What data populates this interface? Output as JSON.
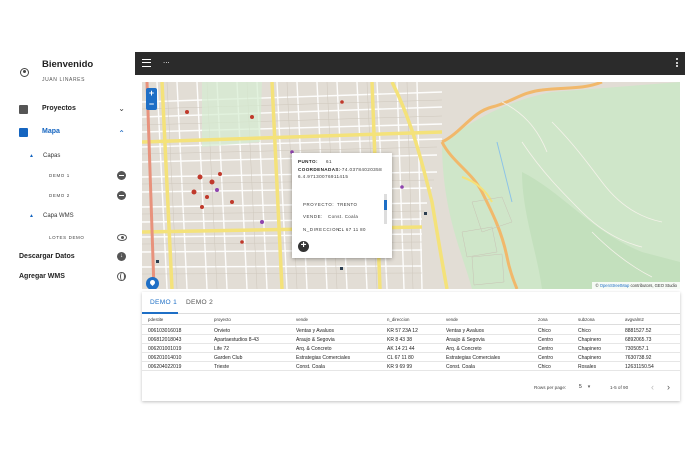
{
  "sidebar": {
    "greeting": "Bienvenido",
    "username": "JUAN LINARES",
    "items": [
      {
        "label": "Proyectos",
        "icon": "folder-icon"
      },
      {
        "label": "Mapa",
        "icon": "map-icon"
      }
    ],
    "capas_label": "Capas",
    "layers": [
      "DEMO 1",
      "DEMO 2"
    ],
    "wms_label": "Capa WMS",
    "wms_layers": [
      "LOTES DEMO"
    ],
    "download_label": "Descargar Datos",
    "add_wms_label": "Agregar WMS"
  },
  "appbar": {
    "title": "...",
    "menu_icon": "hamburger-menu-icon",
    "more_icon": "more-vert-icon"
  },
  "map": {
    "zoom_in": "+",
    "zoom_out": "−",
    "attribution_prefix": "©",
    "attribution_link": "OpenStreetMap",
    "attribution_rest": " contributors, GEO Studio",
    "popup": {
      "punto_label": "PUNTO:",
      "punto_value": "61",
      "coord_label": "COORDENADAS:",
      "coord_value": "-74.03784020358",
      "coord_value2": "6.4.97130076911415",
      "proyecto_label": "PROYECTO:",
      "proyecto_value": "TRENTO",
      "vende_label": "VENDE:",
      "vende_value": "Const. Coala",
      "direccion_label": "N_DIRECCION:",
      "direccion_value": "CL 67 11 80"
    }
  },
  "table": {
    "tabs": [
      "DEMO 1",
      "DEMO 2"
    ],
    "columns": [
      "pdestite",
      "proyecto",
      "vende",
      "n_direccion",
      "vende",
      "zona",
      "subzona",
      "avgvalm2"
    ],
    "rows": [
      [
        "006103016018",
        "Orvieto",
        "Ventas y Avaluos",
        "KR 57 23A 12",
        "Ventas y Avaluos",
        "Chico",
        "Chico",
        "8881527.52"
      ],
      [
        "006812018043",
        "Apartaestudios 8-43",
        "Araujo & Segovia",
        "KR 8 43 38",
        "Araujo & Segovia",
        "Centro",
        "Chapinero",
        "6892065.73"
      ],
      [
        "006201001019",
        "Life 72",
        "Arq. & Concreto",
        "AK 14 21 44",
        "Arq. & Concreto",
        "Centro",
        "Chapinero",
        "7305057.1"
      ],
      [
        "006201014010",
        "Garden Club",
        "Estrategias Comerciales",
        "CL 67 11 80",
        "Estrategias Comerciales",
        "Centro",
        "Chapinero",
        "7630738.92"
      ],
      [
        "006204022019",
        "Trieste",
        "Const. Coala",
        "KR 9 69 99",
        "Const. Coala",
        "Chico",
        "Rosales",
        "12631150.54"
      ]
    ],
    "rows_per_page_label": "Rows per page:",
    "rows_per_page": "5",
    "range": "1-5 of 90"
  },
  "colors": {
    "accent": "#1e6fc6",
    "appbar": "#2b2b2b",
    "park": "#c8e3c4"
  }
}
